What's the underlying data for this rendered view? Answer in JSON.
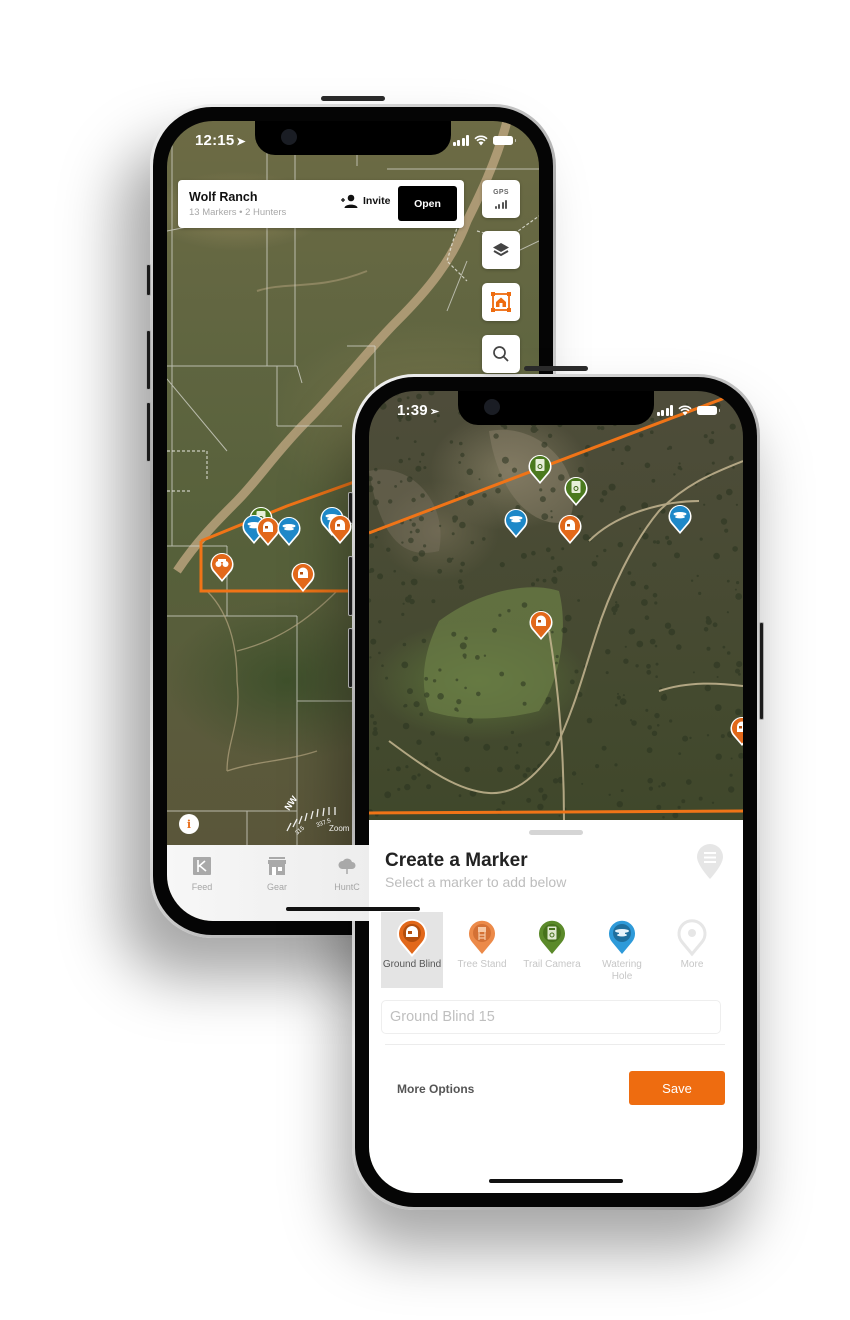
{
  "back_phone": {
    "status_time": "12:15",
    "ranch_card": {
      "title": "Wolf Ranch",
      "subtitle": "13 Markers • 2 Hunters",
      "invite_label": "Invite",
      "open_label": "Open"
    },
    "map_controls": {
      "gps_label": "GPS",
      "layers_icon": "layers-icon",
      "boundary_icon": "property-boundary-icon",
      "search_icon": "search-icon"
    },
    "info_label": "i",
    "compass": {
      "heading": "NW",
      "ticks": [
        "315",
        "337.5"
      ]
    },
    "zoom_label": "Zoom",
    "tabs": [
      {
        "label": "Feed",
        "icon": "feed-icon"
      },
      {
        "label": "Gear",
        "icon": "store-icon"
      },
      {
        "label": "HuntC",
        "icon": "cloud-icon"
      }
    ],
    "markers": [
      {
        "type": "trail-camera",
        "color": "#4b7a1e"
      },
      {
        "type": "watering-hole",
        "color": "#1e88c8"
      },
      {
        "type": "ground-blind",
        "color": "#e2681a"
      },
      {
        "type": "watering-hole",
        "color": "#1e88c8"
      },
      {
        "type": "watering-hole",
        "color": "#1e88c8"
      },
      {
        "type": "ground-blind",
        "color": "#e2681a"
      },
      {
        "type": "observation",
        "color": "#e2681a"
      },
      {
        "type": "ground-blind",
        "color": "#e2681a"
      }
    ]
  },
  "front_phone": {
    "status_time": "1:39",
    "sheet": {
      "title": "Create a Marker",
      "subtitle": "Select a marker to add below",
      "options": [
        {
          "label": "Ground Blind",
          "color": "#e2681a",
          "selected": true
        },
        {
          "label": "Tree Stand",
          "color": "#ec8a49",
          "selected": false
        },
        {
          "label": "Trail Camera",
          "color": "#5b8a2a",
          "selected": false
        },
        {
          "label": "Watering Hole",
          "color": "#2e9ad9",
          "selected": false
        },
        {
          "label": "More",
          "color": "#e9e9e9",
          "selected": false
        }
      ],
      "name_input_placeholder": "Ground Blind 15",
      "name_input_value": "",
      "more_options_label": "More Options",
      "save_label": "Save"
    },
    "markers": [
      {
        "type": "trail-camera",
        "color": "#4b7a1e"
      },
      {
        "type": "trail-camera",
        "color": "#4b7a1e"
      },
      {
        "type": "watering-hole",
        "color": "#1e88c8"
      },
      {
        "type": "ground-blind",
        "color": "#e2681a"
      },
      {
        "type": "watering-hole",
        "color": "#1e88c8"
      },
      {
        "type": "ground-blind",
        "color": "#e2681a"
      }
    ]
  },
  "colors": {
    "accent": "#ee6c10",
    "boundary": "#f07417",
    "open_button": "#000000"
  }
}
